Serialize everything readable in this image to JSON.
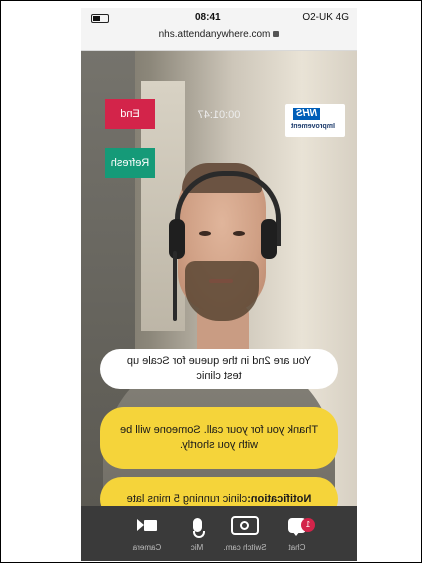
{
  "status_bar": {
    "carrier": "O2-UK 4G",
    "time": "08:41",
    "url": "nhs.attendanywhere.com"
  },
  "call": {
    "end_label": "End",
    "refresh_label": "Refresh",
    "timer": "00:01:47",
    "logo_title": "NHS",
    "logo_subtitle": "Improvement"
  },
  "messages": {
    "queue": "You are 2nd in the queue for Scale up test clinic",
    "thanks": "Thank you for your call. Someone will be with you shortly.",
    "notification_label": "Notification:",
    "notification_text": "clinic running 5 mins late"
  },
  "toolbar": {
    "camera_label": "Camera",
    "mic_label": "Mic",
    "switch_label": "Switch cam.",
    "chat_label": "Chat",
    "chat_badge": "1"
  },
  "colors": {
    "end": "#d3244a",
    "refresh": "#159a78",
    "bubble_yellow": "#f5d43a",
    "toolbar": "#3a3a3a"
  }
}
